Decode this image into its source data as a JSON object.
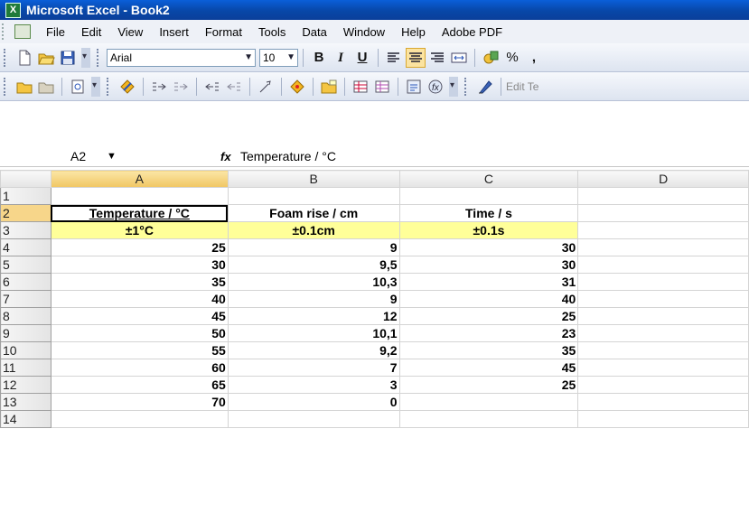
{
  "window": {
    "title": "Microsoft Excel - Book2"
  },
  "menu": [
    "File",
    "Edit",
    "View",
    "Insert",
    "Format",
    "Tools",
    "Data",
    "Window",
    "Help",
    "Adobe PDF"
  ],
  "toolbar1": {
    "font": "Arial",
    "size": "10",
    "bold": "B",
    "italic": "I",
    "underline": "U",
    "percent": "%",
    "comma": ","
  },
  "toolbar2": {
    "edit_text": "Edit Te"
  },
  "formula_bar": {
    "name_box": "A2",
    "fx": "fx",
    "value": "Temperature / °C"
  },
  "columns": [
    "A",
    "B",
    "C",
    "D"
  ],
  "rows": [
    "1",
    "2",
    "3",
    "4",
    "5",
    "6",
    "7",
    "8",
    "9",
    "10",
    "11",
    "12",
    "13",
    "14"
  ],
  "headers": {
    "A": "Temperature / °C",
    "B": "Foam rise / cm",
    "C": "Time / s"
  },
  "uncertainty": {
    "A": "±1°C",
    "B": "±0.1cm",
    "C": "±0.1s"
  },
  "data": [
    {
      "temp": "25",
      "foam": "9",
      "time": "30"
    },
    {
      "temp": "30",
      "foam": "9,5",
      "time": "30"
    },
    {
      "temp": "35",
      "foam": "10,3",
      "time": "31"
    },
    {
      "temp": "40",
      "foam": "9",
      "time": "40"
    },
    {
      "temp": "45",
      "foam": "12",
      "time": "25"
    },
    {
      "temp": "50",
      "foam": "10,1",
      "time": "23"
    },
    {
      "temp": "55",
      "foam": "9,2",
      "time": "35"
    },
    {
      "temp": "60",
      "foam": "7",
      "time": "45"
    },
    {
      "temp": "65",
      "foam": "3",
      "time": "25"
    },
    {
      "temp": "70",
      "foam": "0",
      "time": ""
    }
  ],
  "colors": {
    "title_bar": "#0a4fc0",
    "highlight_row": "#ffff99",
    "selected_header": "#f7d68a"
  }
}
